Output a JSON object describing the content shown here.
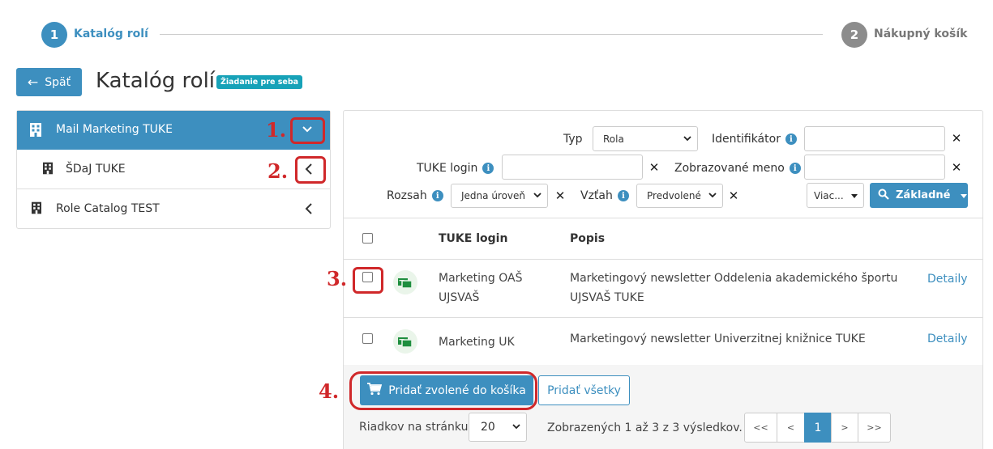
{
  "stepper": {
    "steps": [
      {
        "number": "1",
        "label": "Katalóg rolí",
        "color": "#3d8fbf"
      },
      {
        "number": "2",
        "label": "Nákupný košík",
        "color": "#8c8c8c"
      }
    ]
  },
  "header": {
    "back_label": "Späť",
    "title": "Katalóg rolí",
    "badge": "Žiadanie pre seba"
  },
  "tree": {
    "items": [
      {
        "label": "Mail Marketing TUKE",
        "icon": "building-icon",
        "chevron": "chevron-down-icon"
      },
      {
        "label": "ŠDaJ TUKE",
        "icon": "building-icon",
        "chevron": "chevron-left-icon"
      },
      {
        "label": "Role Catalog TEST",
        "icon": "building-icon",
        "chevron": "chevron-left-icon"
      }
    ]
  },
  "filters": {
    "typ_label": "Typ",
    "typ_value": "Rola",
    "identifikator_label": "Identifikátor",
    "tuke_login_label": "TUKE login",
    "zobrazovane_meno_label": "Zobrazované meno",
    "rozsah_label": "Rozsah",
    "rozsah_value": "Jedna úroveň",
    "vztah_label": "Vzťah",
    "vztah_value": "Predvolené",
    "more_label": "Viac...",
    "search_label": "Základné"
  },
  "table": {
    "columns": [
      "TUKE login",
      "Popis"
    ],
    "rows": [
      {
        "login_line1": "Marketing OAŠ",
        "login_line2": "UJSVAŠ",
        "desc_line1": "Marketingový newsletter Oddelenia akademického športu",
        "desc_line2": "UJSVAŠ TUKE",
        "action": "Detaily"
      },
      {
        "login_line1": "Marketing UK",
        "login_line2": "",
        "desc_line1": "Marketingový newsletter Univerzitnej knižnice TUKE",
        "desc_line2": "",
        "action": "Detaily"
      }
    ]
  },
  "actions": {
    "add_selected": "Pridať zvolené do košíka",
    "add_all": "Pridať všetky"
  },
  "pagination": {
    "rows_label": "Riadkov na stránku",
    "rows_value": "20",
    "summary": "Zobrazených 1 až 3 z 3 výsledkov.",
    "first": "<<",
    "prev": "<",
    "current": "1",
    "next": ">",
    "last": ">>"
  },
  "annotations": [
    "1.",
    "2.",
    "3.",
    "4."
  ],
  "colors": {
    "accent": "#3d8fbf",
    "annotation": "#d0282a",
    "badge": "#17a2b8",
    "role_icon": "#1e8e3e"
  }
}
